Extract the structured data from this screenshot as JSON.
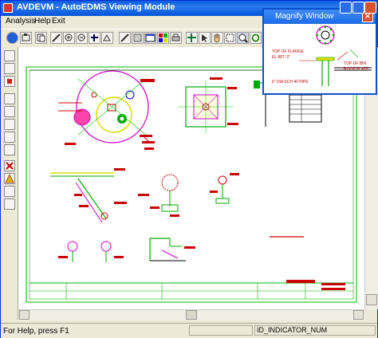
{
  "window": {
    "title": "AVDEVM - AutoEDMS Viewing Module"
  },
  "menu": {
    "items": [
      "Analysis",
      "Help",
      "Exit"
    ]
  },
  "toolbar": {
    "icons": [
      "info-icon",
      "snapshot-icon",
      "zoom-in-icon",
      "zoom-out-icon",
      "fit-icon",
      "pan-icon",
      "layer-icon",
      "color-icon",
      "print-icon",
      "select-icon",
      "hand-icon",
      "zoom-window-icon",
      "magnify-icon",
      "refresh-icon",
      "measure-icon",
      "grid-icon",
      "settings-icon",
      "extra-icon"
    ]
  },
  "magnify": {
    "title": "Magnify Window",
    "labels": {
      "top_of_flange": "TOP OF FLANGE",
      "el": "EL 887'-3\"",
      "top_of_bin": "TOP OF BIN",
      "roof_plate": "ROOF PLATE",
      "pipe": "6\" DIA SCH 40 PIPE"
    }
  },
  "status": {
    "help_text": "For Help, press F1",
    "indicator": "ID_INDICATOR_NUM"
  }
}
